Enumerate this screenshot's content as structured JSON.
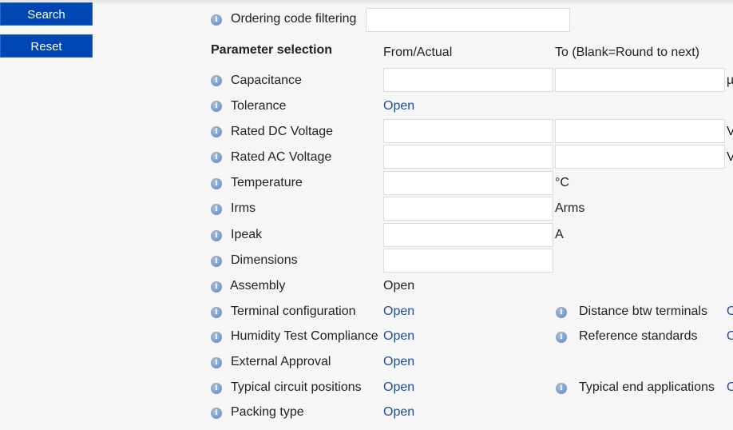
{
  "sidebar": {
    "search_label": "Search",
    "reset_label": "Reset"
  },
  "ordering": {
    "label": "Ordering code filtering",
    "value": ""
  },
  "header": {
    "title": "Parameter selection",
    "from": "From/Actual",
    "to": "To (Blank=Round to next)"
  },
  "params": {
    "capacitance": {
      "label": "Capacitance",
      "unit": "µF"
    },
    "tolerance": {
      "label": "Tolerance",
      "value": "Open"
    },
    "rated_dc": {
      "label": "Rated DC Voltage",
      "unit": "V"
    },
    "rated_ac": {
      "label": "Rated AC Voltage",
      "unit": "V"
    },
    "temperature": {
      "label": "Temperature",
      "unit": "°C"
    },
    "irms": {
      "label": "Irms",
      "unit": "Arms"
    },
    "ipeak": {
      "label": "Ipeak",
      "unit": "A"
    },
    "dimensions": {
      "label": "Dimensions"
    },
    "assembly": {
      "label": "Assembly",
      "value": "Open"
    },
    "terminal": {
      "label": "Terminal configuration",
      "value": "Open"
    },
    "humidity": {
      "label": "Humidity Test Compliance",
      "value": "Open"
    },
    "approval": {
      "label": "External Approval",
      "value": "Open"
    },
    "circuit": {
      "label": "Typical circuit positions",
      "value": "Open"
    },
    "packing": {
      "label": "Packing type",
      "value": "Open"
    },
    "distance": {
      "label": "Distance btw terminals",
      "value": "Open"
    },
    "reference": {
      "label": "Reference standards",
      "value": "Open"
    },
    "end_app": {
      "label": "Typical end applications",
      "value": "Open"
    }
  },
  "icons": {
    "info": "info-icon"
  },
  "colors": {
    "button": "#0047b3",
    "link": "#1d4f9e",
    "background": "#f6f6f6"
  }
}
